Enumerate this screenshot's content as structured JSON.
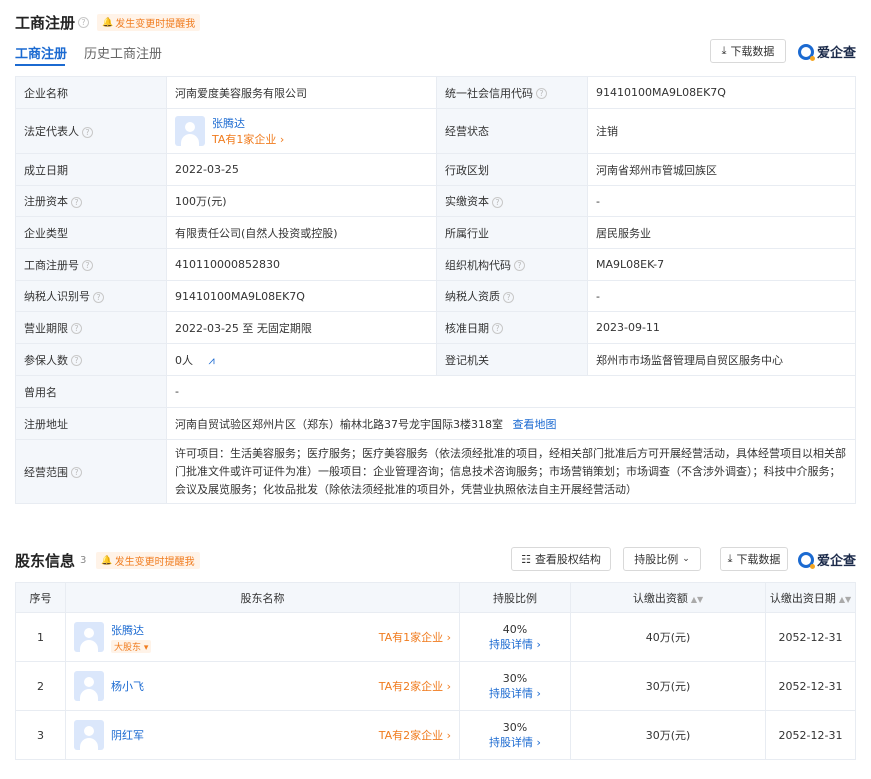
{
  "biz": {
    "title": "工商注册",
    "alert": "发生变更时提醒我",
    "tabs": [
      {
        "label": "工商注册"
      },
      {
        "label": "历史工商注册"
      }
    ],
    "download_label": "下载数据",
    "brand_label": "爱企查",
    "rows": [
      {
        "l1": "企业名称",
        "v1": "河南爱度美容服务有限公司",
        "l2": "统一社会信用代码",
        "v2": "91410100MA9L08EK7Q"
      },
      {
        "l1": "法定代表人",
        "legal_name": "张腾达",
        "legal_link": "TA有1家企业",
        "l2": "经营状态",
        "v2": "注销"
      },
      {
        "l1": "成立日期",
        "v1": "2022-03-25",
        "l2": "行政区划",
        "v2": "河南省郑州市管城回族区"
      },
      {
        "l1": "注册资本",
        "v1": "100万(元)",
        "l2": "实缴资本",
        "v2": "-"
      },
      {
        "l1": "企业类型",
        "v1": "有限责任公司(自然人投资或控股)",
        "l2": "所属行业",
        "v2": "居民服务业"
      },
      {
        "l1": "工商注册号",
        "v1": "410110000852830",
        "l2": "组织机构代码",
        "v2": "MA9L08EK-7"
      },
      {
        "l1": "纳税人识别号",
        "v1": "91410100MA9L08EK7Q",
        "l2": "纳税人资质",
        "v2": "-"
      },
      {
        "l1": "营业期限",
        "v1": "2022-03-25 至 无固定期限",
        "l2": "核准日期",
        "v2": "2023-09-11"
      },
      {
        "l1": "参保人数",
        "v1": "0人",
        "l2": "登记机关",
        "v2": "郑州市市场监督管理局自贸区服务中心"
      },
      {
        "l1": "曾用名",
        "v1": "-"
      },
      {
        "l1": "注册地址",
        "v1": "河南自贸试验区郑州片区（郑东）榆林北路37号龙宇国际3楼318室",
        "map_link": "查看地图"
      },
      {
        "l1": "经营范围",
        "v1": "许可项目：生活美容服务；医疗服务；医疗美容服务（依法须经批准的项目，经相关部门批准后方可开展经营活动，具体经营项目以相关部门批准文件或许可证件为准）一般项目：企业管理咨询；信息技术咨询服务；市场营销策划；市场调查（不含涉外调查）；科技中介服务；会议及展览服务；化妆品批发（除依法须经批准的项目外，凭营业执照依法自主开展经营活动）"
      }
    ]
  },
  "shareholders": {
    "title": "股东信息",
    "count": "3",
    "alert": "发生变更时提醒我",
    "btn_structure": "查看股权结构",
    "btn_ratio": "持股比例",
    "download_label": "下载数据",
    "brand_label": "爱企查",
    "headers": [
      "序号",
      "股东名称",
      "持股比例",
      "认缴出资额",
      "认缴出资日期"
    ],
    "rows": [
      {
        "no": "1",
        "name": "张腾达",
        "badge": "大股东",
        "link": "TA有1家企业",
        "ratio": "40%",
        "detail": "持股详情",
        "amount": "40万(元)",
        "date": "2052-12-31"
      },
      {
        "no": "2",
        "name": "杨小飞",
        "link": "TA有2家企业",
        "ratio": "30%",
        "detail": "持股详情",
        "amount": "30万(元)",
        "date": "2052-12-31"
      },
      {
        "no": "3",
        "name": "阴红军",
        "link": "TA有2家企业",
        "ratio": "30%",
        "detail": "持股详情",
        "amount": "30万(元)",
        "date": "2052-12-31"
      }
    ]
  }
}
